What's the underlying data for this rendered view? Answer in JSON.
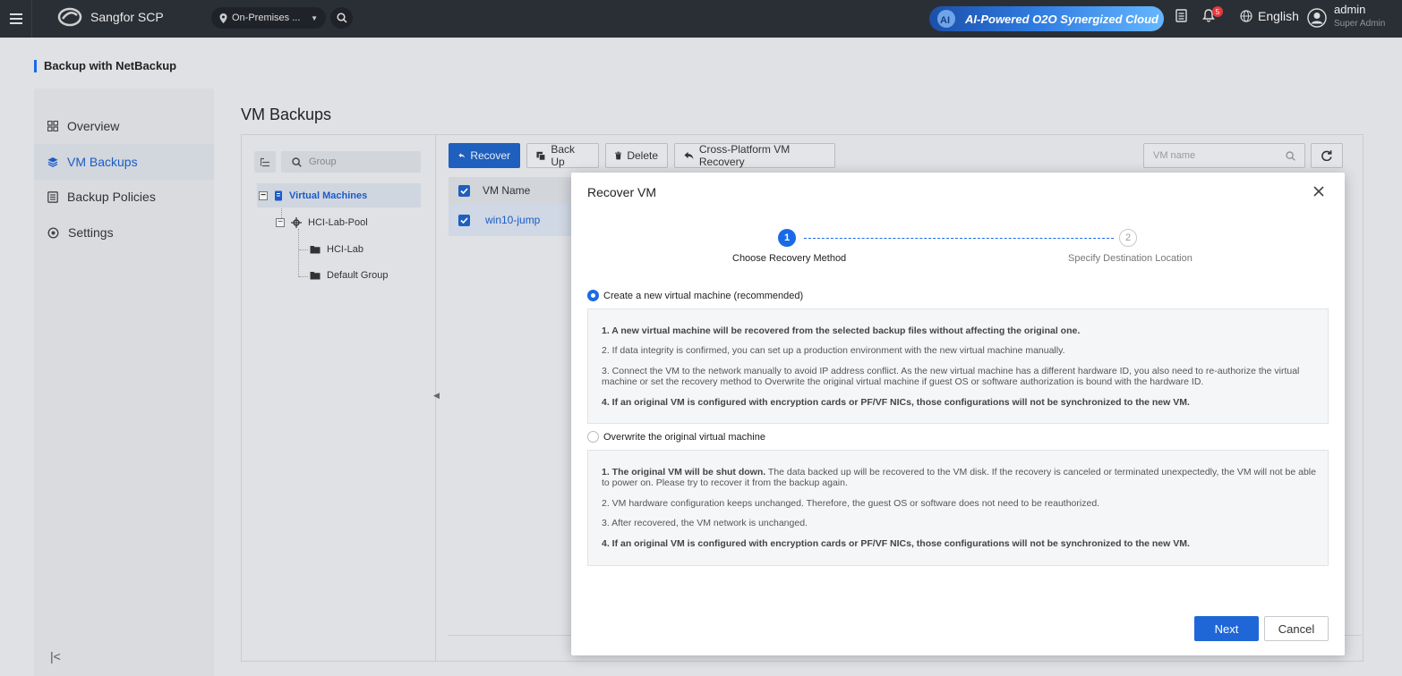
{
  "topbar": {
    "app_name": "Sangfor SCP",
    "env_selector": "On-Premises ...",
    "banner": "AI-Powered O2O Synergized Cloud",
    "notification_count": "5",
    "language": "English",
    "user_name": "admin",
    "user_role": "Super Admin"
  },
  "page": {
    "title": "Backup with NetBackup"
  },
  "sidebar": {
    "items": [
      {
        "label": "Overview",
        "icon": "grid-icon"
      },
      {
        "label": "VM Backups",
        "icon": "layers-icon",
        "active": true
      },
      {
        "label": "Backup Policies",
        "icon": "list-icon"
      },
      {
        "label": "Settings",
        "icon": "gear-icon"
      }
    ]
  },
  "main": {
    "title": "VM Backups",
    "tree": {
      "search_placeholder": "Group",
      "root": "Virtual Machines",
      "pool": "HCI-Lab-Pool",
      "groups": [
        "HCI-Lab",
        "Default Group"
      ]
    },
    "toolbar": {
      "recover": "Recover",
      "backup": "Back Up",
      "delete": "Delete",
      "cross_platform": "Cross-Platform VM Recovery",
      "search_placeholder": "VM name"
    },
    "table": {
      "header": "VM Name",
      "rows": [
        "win10-jump"
      ]
    }
  },
  "modal": {
    "title": "Recover VM",
    "steps": [
      {
        "num": "1",
        "label": "Choose Recovery Method"
      },
      {
        "num": "2",
        "label": "Specify Destination Location"
      }
    ],
    "option1": {
      "label": "Create a new virtual machine (recommended)",
      "selected": true,
      "lines": [
        "1. A new virtual machine will be recovered from the selected backup files without affecting the original one.",
        "2. If data integrity is confirmed, you can set up a production environment with the new virtual machine manually.",
        "3. Connect the VM to the network manually to avoid IP address conflict. As the new virtual machine has a different hardware ID, you also need to re-authorize the virtual machine or set the recovery method to Overwrite the original virtual machine if guest OS or software authorization is bound with the hardware ID.",
        "4. If an original VM is configured with encryption cards or PF/VF NICs, those configurations will not be synchronized to the new VM."
      ]
    },
    "option2": {
      "label": "Overwrite the original virtual machine",
      "selected": false,
      "line1_bold": "1. The original VM will be shut down.",
      "line1_rest": " The data backed up will be recovered to the VM disk. If the recovery is canceled or terminated unexpectedly, the VM will not be able to power on. Please try to recover it from the backup again.",
      "lines": [
        "2. VM hardware configuration keeps unchanged. Therefore, the guest OS or software does not need to be reauthorized.",
        "3. After recovered, the VM network is unchanged.",
        "4. If an original VM is configured with encryption cards or PF/VF NICs, those configurations will not be synchronized to the new VM."
      ]
    },
    "next": "Next",
    "cancel": "Cancel"
  },
  "colors": {
    "accent": "#1a6ae5",
    "topbar": "#2a2f36"
  }
}
